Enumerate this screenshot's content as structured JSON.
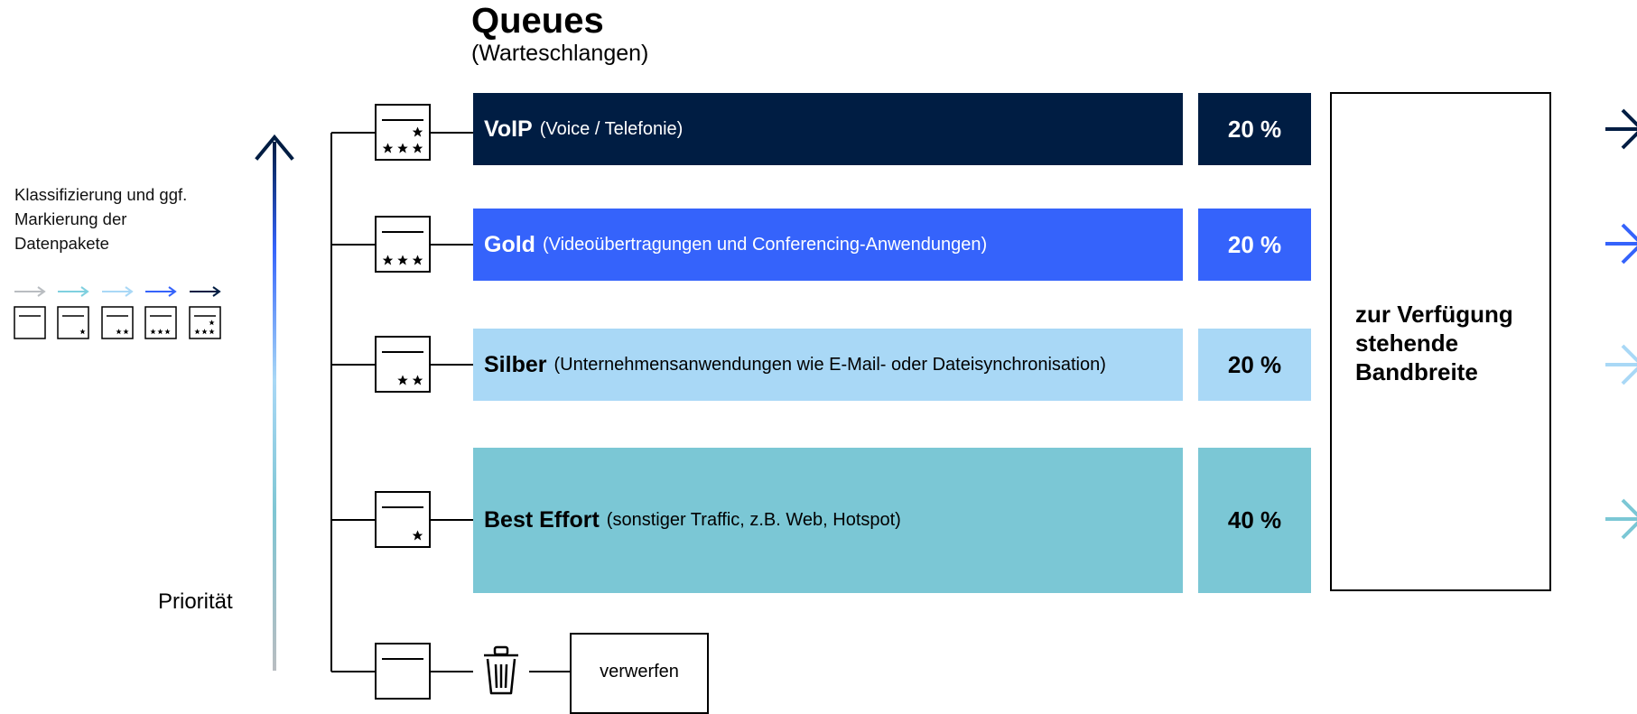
{
  "header": {
    "title": "Queues",
    "subtitle": "(Warteschlangen)"
  },
  "classification": {
    "label": "Klassifizierung und ggf. Markierung der Datenpakete"
  },
  "priority": {
    "label": "Priorität"
  },
  "queues": [
    {
      "name": "VoIP",
      "description": "(Voice / Telefonie)",
      "percent": "20 %",
      "color": "#001d43",
      "stars": 3
    },
    {
      "name": "Gold",
      "description": "(Videoübertragungen und Conferencing-Anwendungen)",
      "percent": "20 %",
      "color": "#3563fb",
      "stars": 3
    },
    {
      "name": "Silber",
      "description": "(Unternehmensanwendungen wie E-Mail- oder Dateisynchronisation)",
      "percent": "20 %",
      "color": "#a9d8f6",
      "stars": 2
    },
    {
      "name": "Best Effort",
      "description": "(sonstiger Traffic, z.B. Web, Hotspot)",
      "percent": "40 %",
      "color": "#7bc7d5",
      "stars": 1
    }
  ],
  "bandwidth": {
    "label": "zur Verfügung stehende Bandbreite"
  },
  "discard": {
    "label": "verwerfen",
    "icon": "trash-icon"
  },
  "colors": {
    "arrow_grey": "#b9bdc1",
    "arrow_light_teal": "#7fd0df",
    "arrow_light_blue": "#a9d8f6",
    "arrow_blue": "#3563fb",
    "arrow_navy": "#001d43"
  }
}
